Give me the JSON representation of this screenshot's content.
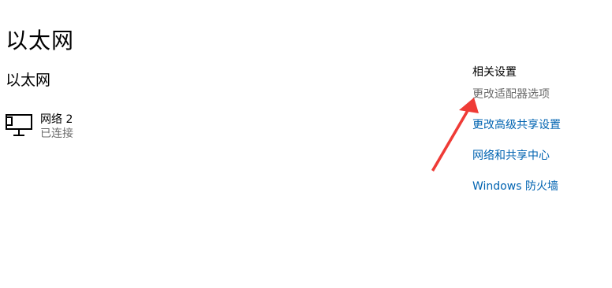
{
  "page": {
    "title": "以太网"
  },
  "section": {
    "title": "以太网"
  },
  "network": {
    "name": "网络 2",
    "status": "已连接",
    "icon": "network-monitor-icon"
  },
  "related": {
    "title": "相关设置",
    "links": [
      {
        "label": "更改适配器选项",
        "color": "#6b6b6b"
      },
      {
        "label": "更改高级共享设置",
        "color": "#0063b1"
      },
      {
        "label": "网络和共享中心",
        "color": "#0063b1"
      },
      {
        "label": "Windows 防火墙",
        "color": "#0063b1"
      }
    ]
  },
  "annotation": {
    "color": "#ef3b36"
  }
}
